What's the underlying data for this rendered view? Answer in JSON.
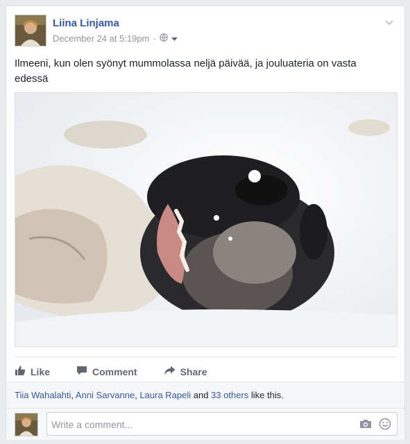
{
  "post": {
    "author": "Liina Linjama",
    "timestamp": "December 24 at 5:19pm",
    "separator": "·",
    "privacy_icon": "globe-icon",
    "text": "Ilmeeni, kun olen syönyt mummolassa neljä päivää, ja jouluateria on vasta edessä",
    "photo_icon": "dog-in-snow-photo"
  },
  "actions": {
    "like": "Like",
    "comment": "Comment",
    "share": "Share"
  },
  "likes": {
    "name1": "Tiia Wahalahti",
    "sep1": ", ",
    "name2": "Anni Sarvanne",
    "sep2": ", ",
    "name3": "Laura Rapeli",
    "and_text": " and ",
    "others": "33 others",
    "suffix": " like this."
  },
  "comment": {
    "placeholder": "Write a comment..."
  },
  "colors": {
    "link": "#365899",
    "muted": "#90949c",
    "action": "#606770"
  }
}
